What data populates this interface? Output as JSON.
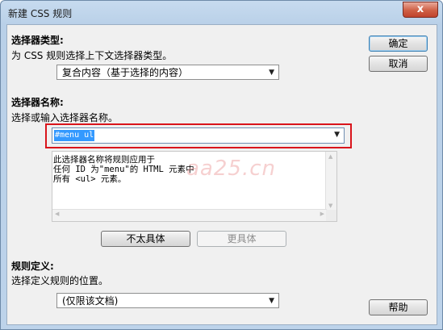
{
  "window": {
    "title": "新建 CSS 规则",
    "close_label": "x"
  },
  "selector_type": {
    "heading": "选择器类型:",
    "description": "为 CSS 规则选择上下文选择器类型。",
    "selected": "复合内容（基于选择的内容）"
  },
  "selector_name": {
    "heading": "选择器名称:",
    "description": "选择或输入选择器名称。",
    "value": "#menu ul",
    "detail_lines": [
      "此选择器名称将规则应用于",
      "任何 ID 为\"menu\"的 HTML 元素中",
      "所有 <ul> 元素。"
    ],
    "less_specific_label": "不太具体",
    "more_specific_label": "更具体"
  },
  "rule_definition": {
    "heading": "规则定义:",
    "description": "选择定义规则的位置。",
    "selected": "(仅限该文档)"
  },
  "buttons": {
    "ok": "确定",
    "cancel": "取消",
    "help": "帮助"
  },
  "watermark": "aa25.cn",
  "colors": {
    "highlight": "#d9141b",
    "selection": "#3399ff"
  }
}
